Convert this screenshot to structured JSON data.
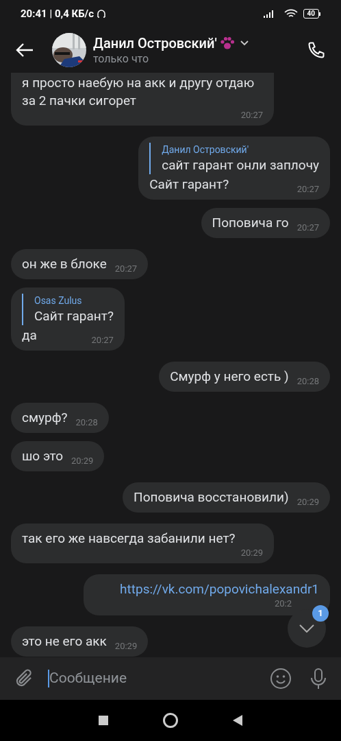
{
  "status_bar": {
    "text": "20:41 | 0,4 КБ/с",
    "battery": "40"
  },
  "header": {
    "name": "Данил Островский'",
    "status": "только что"
  },
  "messages": [
    {
      "outgoing": false,
      "kind": "text",
      "text": "я просто наебую на акк и другу отдаю за 2 пачки сигорет",
      "time": "20:27"
    },
    {
      "outgoing": true,
      "kind": "text",
      "reply": {
        "author": "Данил Островский'",
        "text": "сайт гарант онли заплочу"
      },
      "text": "Сайт гарант?",
      "time": "20:27"
    },
    {
      "outgoing": true,
      "kind": "text",
      "text": "Поповича го",
      "time": "20:27"
    },
    {
      "outgoing": false,
      "kind": "text",
      "text": "он же в блоке",
      "time": "20:27"
    },
    {
      "outgoing": false,
      "kind": "text",
      "reply": {
        "author": "Osas Zulus",
        "text": "Сайт гарант?"
      },
      "text": "да",
      "time": "20:27"
    },
    {
      "outgoing": true,
      "kind": "text",
      "text": "Смурф у него есть )",
      "time": "20:28"
    },
    {
      "outgoing": false,
      "kind": "text",
      "text": "смурф?",
      "time": "20:28"
    },
    {
      "outgoing": false,
      "kind": "text",
      "text": "шо это",
      "time": "20:29"
    },
    {
      "outgoing": true,
      "kind": "text",
      "text": "Поповича восстановили)",
      "time": "20:29"
    },
    {
      "outgoing": false,
      "kind": "text",
      "text": "так его же навсегда забанили нет?",
      "time": "20:29"
    },
    {
      "outgoing": true,
      "kind": "link",
      "text": "https://vk.com/popovichalexandr1",
      "time": "20:2"
    },
    {
      "outgoing": false,
      "kind": "text",
      "text": "это не его акк",
      "time": "20:29"
    }
  ],
  "scroll_button": {
    "badge": "1"
  },
  "composer": {
    "placeholder": "Сообщение"
  }
}
